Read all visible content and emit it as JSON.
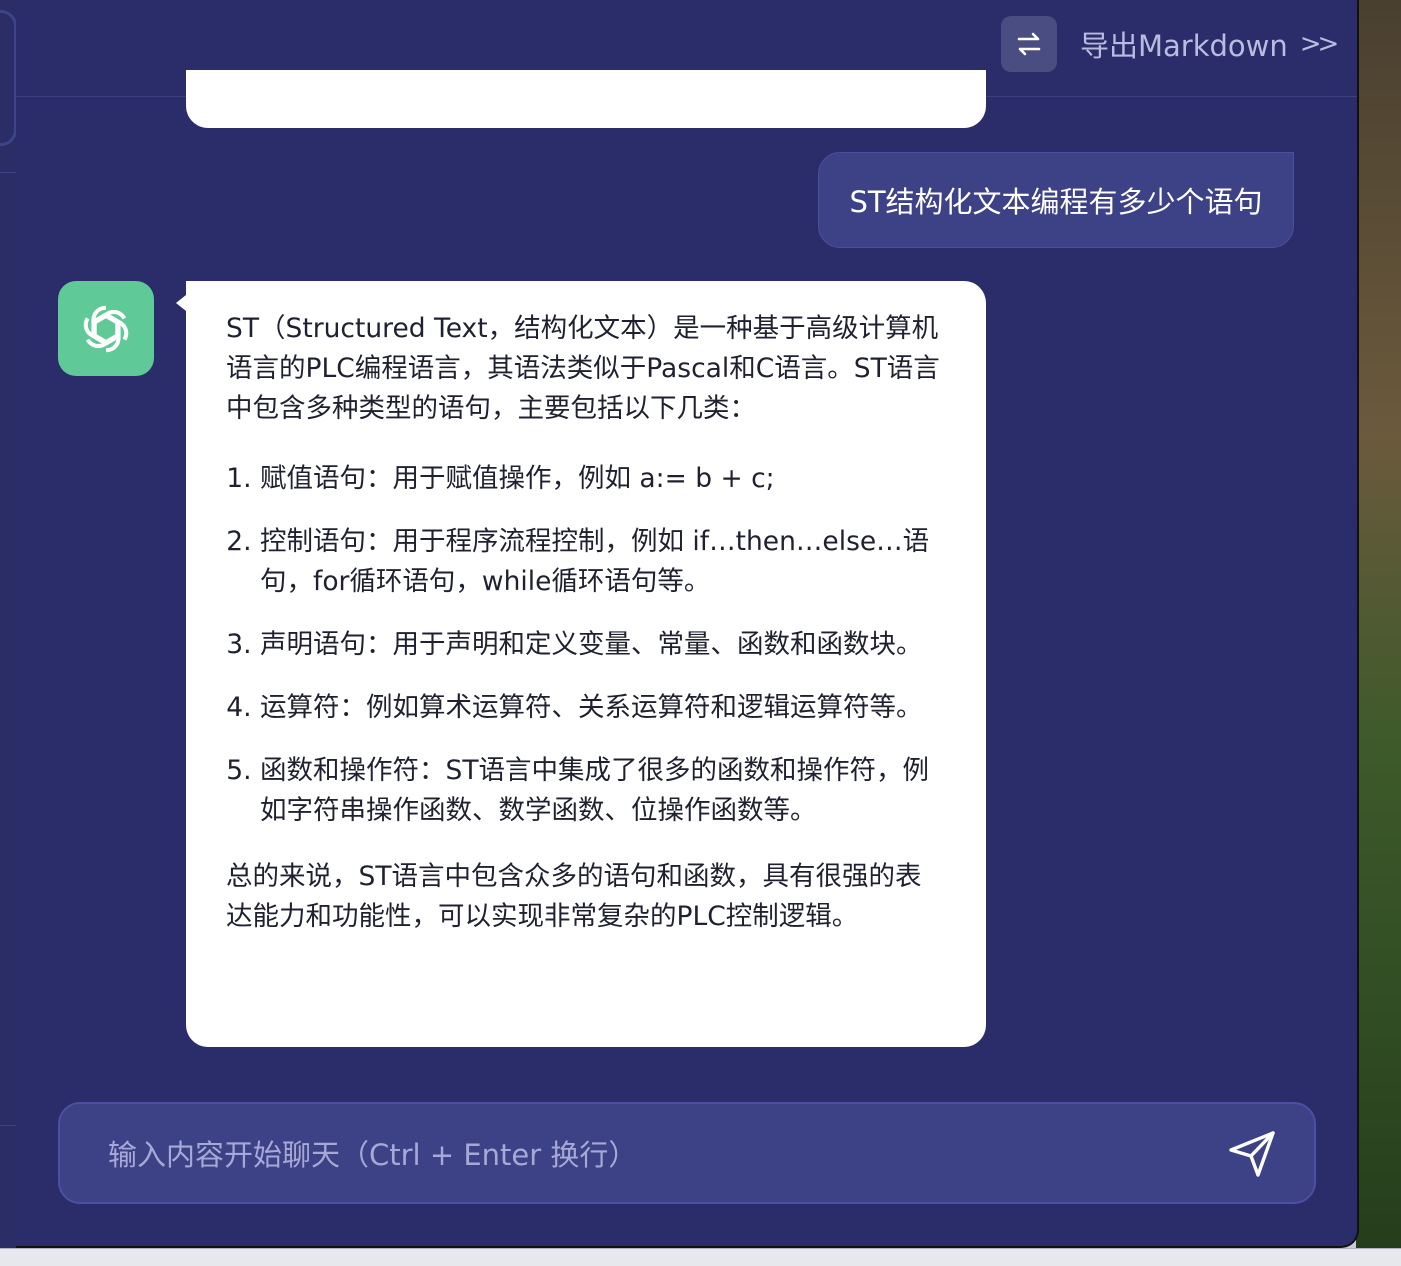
{
  "header": {
    "swap_icon": "swap-arrows-icon",
    "export_label": "导出Markdown",
    "export_chevron": ">>"
  },
  "conversation": {
    "user_message": "ST结构化文本编程有多少个语句",
    "assistant_avatar_icon": "openai-logo-icon",
    "assistant": {
      "intro": "ST（Structured Text，结构化文本）是一种基于高级计算机语言的PLC编程语言，其语法类似于Pascal和C语言。ST语言中包含多种类型的语句，主要包括以下几类：",
      "items": [
        "赋值语句：用于赋值操作，例如 a:= b + c;",
        "控制语句：用于程序流程控制，例如 if…then…else…语句，for循环语句，while循环语句等。",
        "声明语句：用于声明和定义变量、常量、函数和函数块。",
        "运算符：例如算术运算符、关系运算符和逻辑运算符等。",
        "函数和操作符：ST语言中集成了很多的函数和操作符，例如字符串操作函数、数学函数、位操作函数等。"
      ],
      "summary": "总的来说，ST语言中包含众多的语句和函数，具有很强的表达能力和功能性，可以实现非常复杂的PLC控制逻辑。"
    }
  },
  "input": {
    "placeholder": "输入内容开始聊天（Ctrl + Enter 换行）",
    "value": "",
    "send_icon": "send-icon"
  },
  "colors": {
    "background": "#2b2d6a",
    "bubble_user": "#3d4186",
    "bubble_bot": "#ffffff",
    "avatar": "#5fc997"
  }
}
